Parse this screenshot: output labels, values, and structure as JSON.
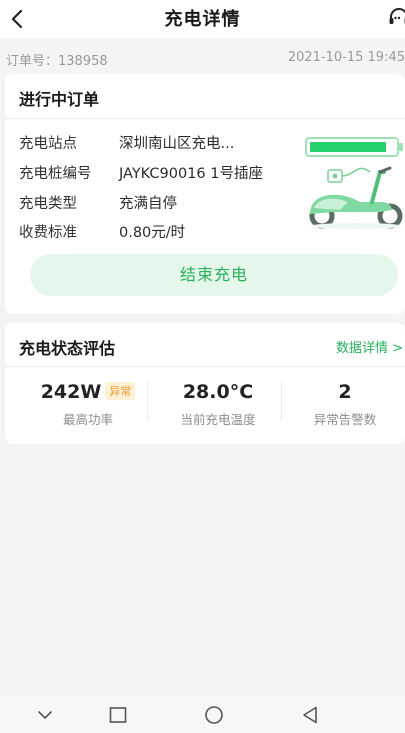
{
  "header": {
    "title": "充电详情",
    "back_icon": "chevron-left-icon",
    "support_icon": "headset-icon"
  },
  "order_meta": {
    "order_no": "订单号：138958",
    "time": "2021-10-15 19:45"
  },
  "order_card": {
    "title": "进行中订单",
    "rows": [
      {
        "key": "充电站点",
        "value": "深圳南山区充电..."
      },
      {
        "key": "充电桩编号",
        "value": "JAYKC90016 1号插座"
      },
      {
        "key": "充电类型",
        "value": "充满自停"
      },
      {
        "key": "收费标准",
        "value": "0.80元/时"
      }
    ],
    "battery_level": 0.9,
    "end_button": "结束充电"
  },
  "status_card": {
    "title": "充电状态评估",
    "detail_link": "数据详情 >",
    "stats": [
      {
        "value": "242W",
        "badge": "异常",
        "label": "最高功率"
      },
      {
        "value": "28.0°C",
        "label": "当前充电温度"
      },
      {
        "value": "2",
        "label": "异常告警数"
      }
    ]
  },
  "navbar": {
    "icons": [
      "chevron-down-icon",
      "square-icon",
      "circle-icon",
      "triangle-back-icon"
    ]
  },
  "colors": {
    "accent": "#28b15a",
    "accent_light": "#e5f6ea",
    "badge_bg": "#fff1d6",
    "badge_text": "#e89a2a"
  }
}
